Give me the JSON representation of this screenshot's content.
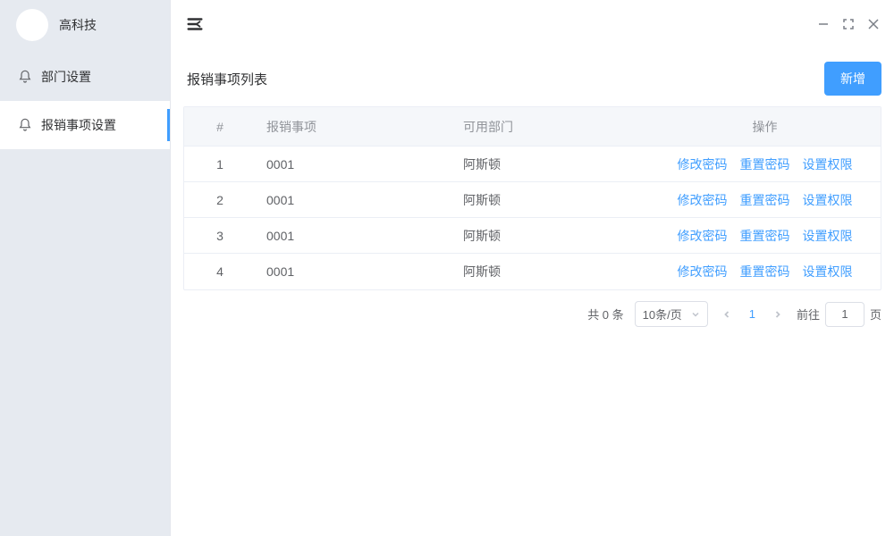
{
  "sidebar": {
    "brand": "高科技",
    "items": [
      {
        "label": "部门设置"
      },
      {
        "label": "报销事项设置"
      }
    ],
    "activeIndex": 1
  },
  "page": {
    "title": "报销事项列表",
    "addButton": "新增"
  },
  "table": {
    "headers": {
      "index": "#",
      "name": "报销事项",
      "dept": "可用部门",
      "ops": "操作"
    },
    "rows": [
      {
        "idx": "1",
        "name": "0001",
        "dept": "阿斯顿"
      },
      {
        "idx": "2",
        "name": "0001",
        "dept": "阿斯顿"
      },
      {
        "idx": "3",
        "name": "0001",
        "dept": "阿斯顿"
      },
      {
        "idx": "4",
        "name": "0001",
        "dept": "阿斯顿"
      }
    ],
    "actions": {
      "a1": "修改密码",
      "a2": "重置密码",
      "a3": "设置权限"
    }
  },
  "pagination": {
    "total": "共 0 条",
    "pageSize": "10条/页",
    "current": "1",
    "jumpPrefix": "前往",
    "jumpValue": "1",
    "jumpSuffix": "页"
  }
}
